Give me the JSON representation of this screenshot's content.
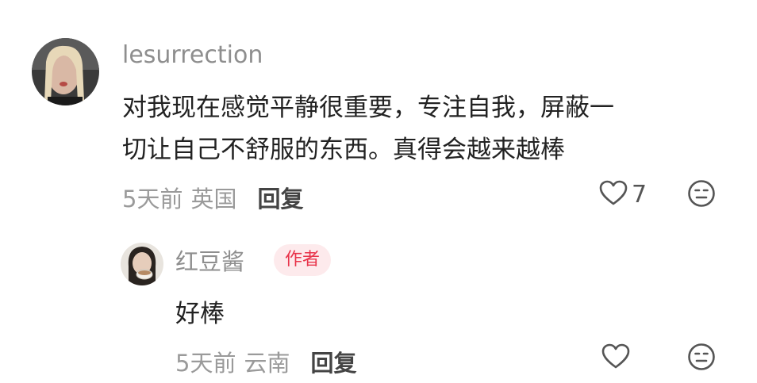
{
  "comments": [
    {
      "username": "lesurrection",
      "text_lines": [
        "对我现在感觉平静很重要，专注自我，屏蔽一",
        "切让自己不舒服的东西。真得会越来越棒"
      ],
      "time": "5天前",
      "location": "英国",
      "reply_label": "回复",
      "like_count": "7"
    },
    {
      "username": "红豆酱",
      "badge": "作者",
      "text": "好棒",
      "time": "5天前",
      "location": "云南",
      "reply_label": "回复"
    }
  ]
}
